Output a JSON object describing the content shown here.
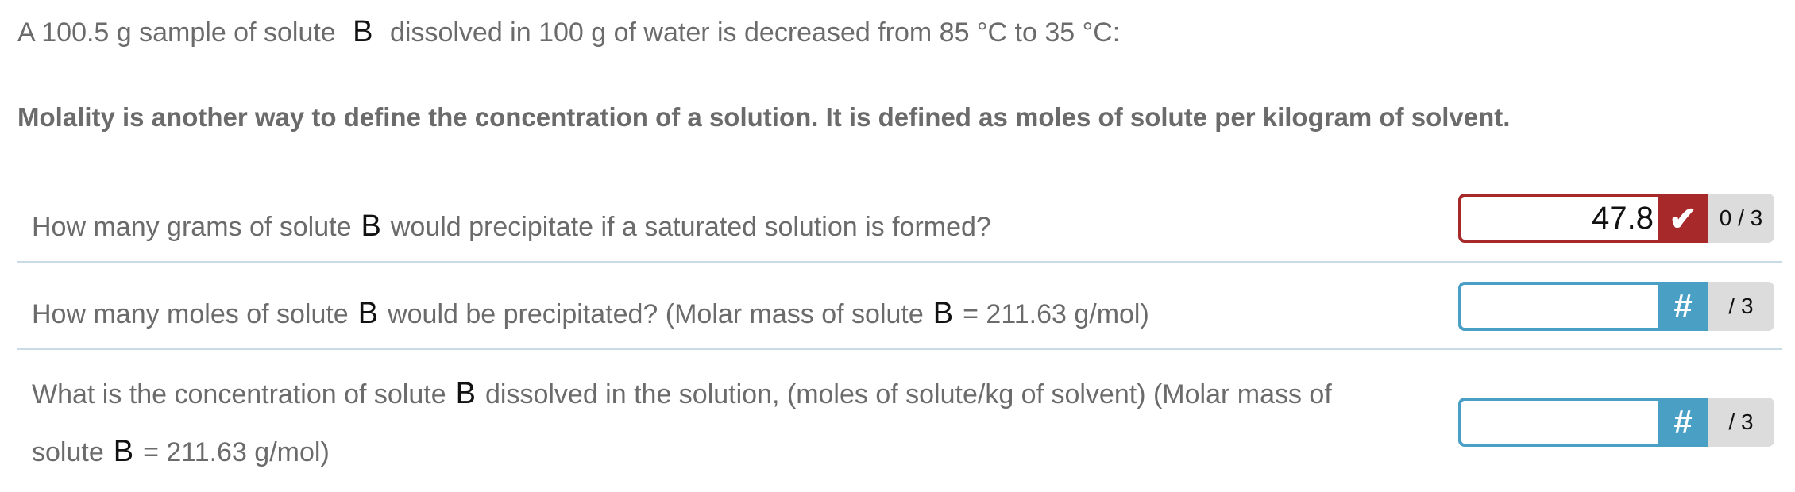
{
  "intro": {
    "prefix": "A 100.5 g sample of solute",
    "var": "B",
    "suffix": "dissolved in 100 g of water is decreased from 85 °C to 35 °C:"
  },
  "molality_note": "Molality is another way to define the concentration of a solution. It is defined as moles of solute per kilogram of solvent.",
  "questions": [
    {
      "part1": "How many grams of solute",
      "var": "B",
      "part2": "would precipitate if a saturated solution is formed?",
      "answer_value": "47.8",
      "badge": "✔",
      "badge_icon": "checkmark-icon",
      "score": "0 / 3",
      "status_color": "#a8292a"
    },
    {
      "part1": "How many moles of solute",
      "var": "B",
      "part2": "would be precipitated? (Molar mass of solute",
      "var2": "B",
      "part3": "= 211.63 g/mol)",
      "answer_value": "",
      "badge": "#",
      "badge_icon": "hash-icon",
      "score": "/ 3",
      "status_color": "#4a9fc5"
    },
    {
      "part1": "What is the concentration of solute",
      "var": "B",
      "part2": "dissolved in the solution, (moles of solute/kg of solvent) (Molar mass of solute",
      "var2": "B",
      "part3": "= 211.63 g/mol)",
      "answer_value": "",
      "badge": "#",
      "badge_icon": "hash-icon",
      "score": "/ 3",
      "status_color": "#4a9fc5"
    }
  ]
}
